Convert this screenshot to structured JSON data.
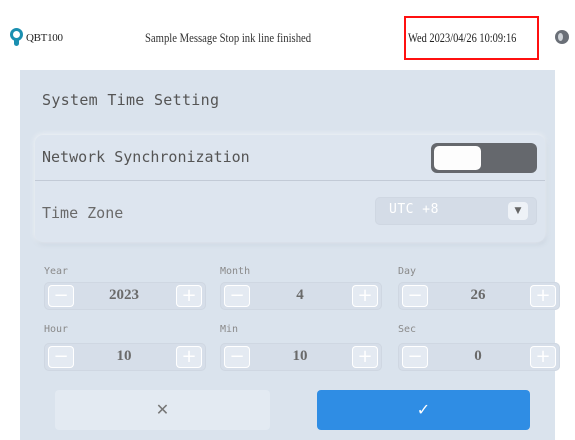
{
  "header": {
    "app_name": "QBT100",
    "message": "Sample Message Stop ink line finished",
    "datetime": "Wed 2023/04/26 10:09:16"
  },
  "panel": {
    "title": "System Time Setting",
    "network_sync": {
      "label": "Network Synchronization",
      "enabled": false
    },
    "time_zone": {
      "label": "Time Zone",
      "value": "UTC +8",
      "dropdown_icon": "chevron-down-icon"
    }
  },
  "fields": [
    {
      "label": "Year",
      "value": "2023"
    },
    {
      "label": "Month",
      "value": "4"
    },
    {
      "label": "Day",
      "value": "26"
    },
    {
      "label": "Hour",
      "value": "10"
    },
    {
      "label": "Min",
      "value": "10"
    },
    {
      "label": "Sec",
      "value": "0"
    }
  ],
  "stepper_symbols": {
    "minus": "−",
    "plus": "+"
  },
  "actions": {
    "cancel": "✕",
    "confirm": "✓"
  },
  "colors": {
    "accent": "#2f8de4",
    "panel_bg": "#dae3ed",
    "toggle_track": "#65686d",
    "clock_highlight": "#ff1010",
    "logo": "#1a8fb0"
  }
}
